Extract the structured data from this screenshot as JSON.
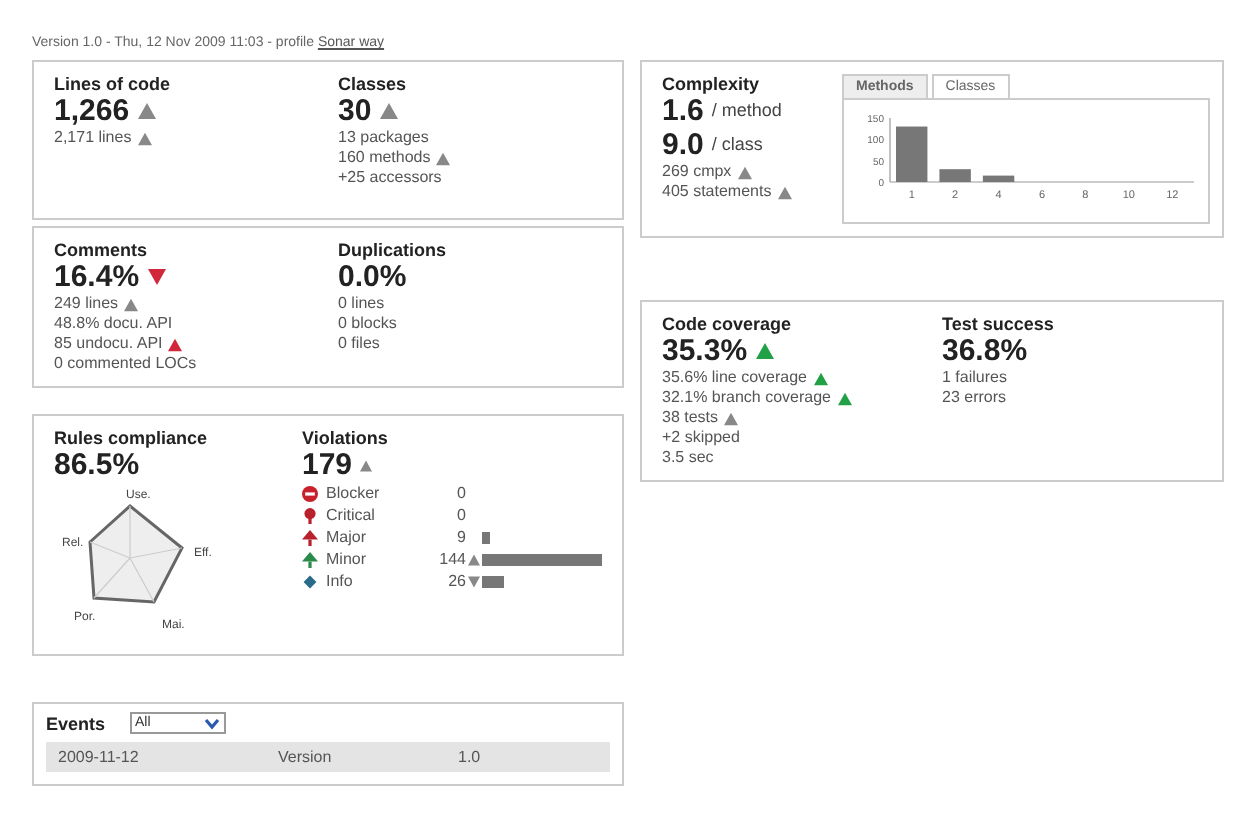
{
  "header": {
    "text": "Version 1.0 - Thu, 12 Nov 2009 11:03 - profile ",
    "link": "Sonar way"
  },
  "left": [
    {
      "kind": "pair",
      "widgets": [
        {
          "title": "Lines of code",
          "value": "1,266",
          "trend": {
            "rising": true,
            "color": "#888888"
          },
          "lines": [
            {
              "text": "2,171 lines",
              "trend": {
                "rising": true,
                "color": "#888888"
              }
            }
          ]
        },
        {
          "title": "Classes",
          "value": "30",
          "trend": {
            "rising": true,
            "color": "#888888"
          },
          "lines": [
            {
              "text": "13 packages"
            },
            {
              "text": "160 methods",
              "trend": {
                "rising": true,
                "color": "#888888"
              }
            },
            {
              "text": "+25 accessors"
            }
          ]
        }
      ]
    },
    {
      "kind": "pair",
      "widgets": [
        {
          "title": "Comments",
          "value": "16.4%",
          "trend": {
            "rising": false,
            "color": "#d0283a"
          },
          "lines": [
            {
              "text": "249 lines",
              "trend": {
                "rising": true,
                "color": "#888888"
              }
            },
            {
              "text": "48.8% docu. API"
            },
            {
              "text": "85 undocu. API",
              "trend": {
                "rising": true,
                "color": "#d0283a"
              }
            },
            {
              "text": "0 commented LOCs"
            }
          ]
        },
        {
          "title": "Duplications",
          "value": "0.0%",
          "lines": [
            {
              "text": "0 lines"
            },
            {
              "text": "0 blocks"
            },
            {
              "text": "0 files"
            }
          ]
        }
      ]
    }
  ],
  "rules": {
    "title": "Rules compliance",
    "value": "86.5%",
    "axes": [
      "Use.",
      "Rel.",
      "Eff.",
      "Por.",
      "Mai."
    ]
  },
  "violations": {
    "title": "Violations",
    "value": "179",
    "trend": {
      "rising": true,
      "color": "#888888"
    },
    "rows": [
      {
        "kind": "blocker",
        "label": "Blocker",
        "count": "0"
      },
      {
        "kind": "critical",
        "label": "Critical",
        "count": "0"
      },
      {
        "kind": "major",
        "label": "Major",
        "count": "9"
      },
      {
        "kind": "minor",
        "label": "Minor",
        "count": "144",
        "trend": {
          "rising": true,
          "color": "#888888"
        }
      },
      {
        "kind": "info",
        "label": "Info",
        "count": "26",
        "trend": {
          "rising": false,
          "color": "#888888"
        }
      }
    ]
  },
  "events": {
    "title": "Events",
    "filter": "All",
    "rows": [
      {
        "date": "2009-11-12",
        "category": "Version",
        "name": "1.0"
      }
    ]
  },
  "complexity": {
    "title": "Complexity",
    "metrics": [
      {
        "value": "1.6",
        "unit": "/ method"
      },
      {
        "value": "9.0",
        "unit": "/ class"
      }
    ],
    "lines": [
      {
        "text": "269 cmpx",
        "trend": {
          "rising": true,
          "color": "#888888"
        }
      },
      {
        "text": "405 statements",
        "trend": {
          "rising": true,
          "color": "#888888"
        }
      }
    ],
    "tabs": [
      {
        "label": "Methods",
        "selected": true
      },
      {
        "label": "Classes",
        "selected": false
      }
    ],
    "chart_data": {
      "type": "bar",
      "categories": [
        "1",
        "2",
        "4",
        "6",
        "8",
        "10",
        "12"
      ],
      "values": [
        130,
        30,
        15,
        0,
        0,
        0,
        0
      ],
      "ylim": [
        0,
        150
      ],
      "yticks": [
        0,
        50,
        100,
        150
      ]
    }
  },
  "coverage": [
    {
      "title": "Code coverage",
      "value": "35.3%",
      "trend": {
        "rising": true,
        "color": "#22a045"
      },
      "lines": [
        {
          "text": "35.6% line coverage",
          "trend": {
            "rising": true,
            "color": "#22a045"
          }
        },
        {
          "text": "32.1% branch coverage",
          "trend": {
            "rising": true,
            "color": "#22a045"
          }
        },
        {
          "text": "38 tests",
          "trend": {
            "rising": true,
            "color": "#888888"
          }
        },
        {
          "text": "+2 skipped"
        },
        {
          "text": "3.5 sec"
        }
      ]
    },
    {
      "title": "Test success",
      "value": "36.8%",
      "lines": [
        {
          "text": "1 failures"
        },
        {
          "text": "23 errors"
        }
      ]
    }
  ]
}
